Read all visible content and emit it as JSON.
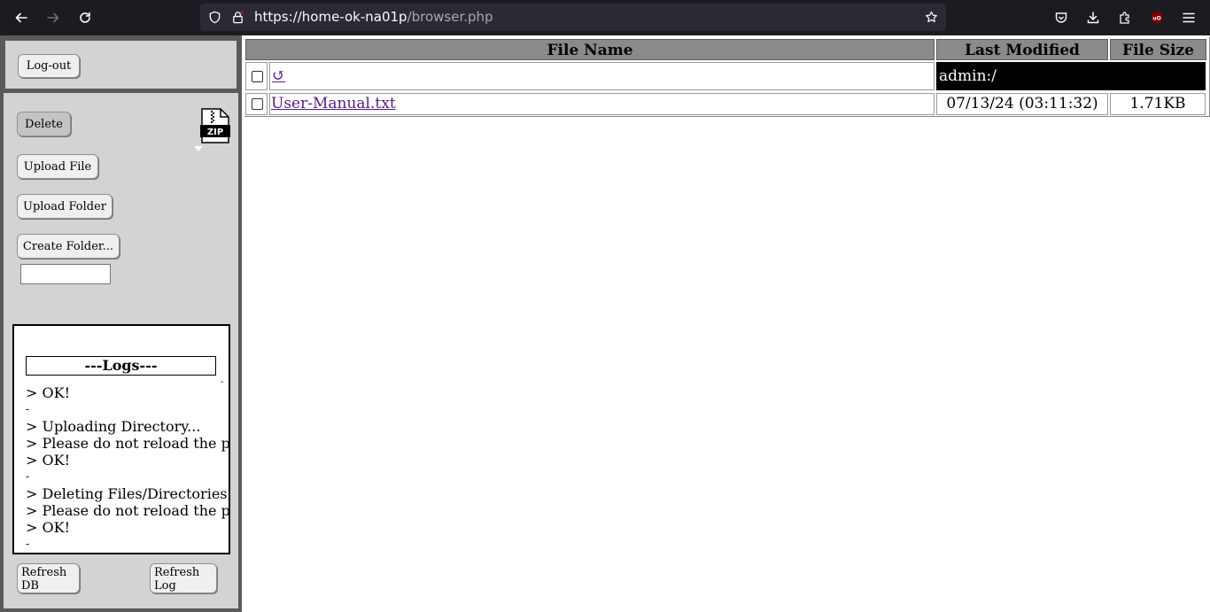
{
  "browser": {
    "url_host": "https://home-ok-na01p",
    "url_path": "/browser.php",
    "icons": [
      "back-icon",
      "forward-icon",
      "reload-icon",
      "shield-icon",
      "lock-icon",
      "bookmark-star-icon",
      "pocket-icon",
      "download-icon",
      "extensions-icon",
      "ublock-icon",
      "menu-icon"
    ]
  },
  "sidebar": {
    "logout_label": "Log-out",
    "delete_label": "Delete",
    "upload_file_label": "Upload File",
    "upload_folder_label": "Upload Folder",
    "create_folder_label": "Create Folder...",
    "folder_name_value": "",
    "zip_label": "ZIP",
    "logs": {
      "title": "---Logs---",
      "side_dash": "-",
      "lines": [
        "> OK!",
        "-",
        "> Uploading Directory...",
        "> Please do not reload the p",
        "> OK!",
        "-",
        "> Deleting Files/Directories",
        "> Please do not reload the p",
        "> OK!",
        "-"
      ]
    },
    "refresh_db_line1": "Refresh",
    "refresh_db_line2": "DB",
    "refresh_log_line1": "Refresh",
    "refresh_log_line2": "Log"
  },
  "table": {
    "headers": {
      "file_name": "File Name",
      "last_modified": "Last Modified",
      "file_size": "File Size"
    },
    "parent_row": {
      "icon": "↺",
      "path": "admin:/"
    },
    "rows": [
      {
        "name": "User-Manual.txt",
        "modified": "07/13/24 (03:11:32)",
        "size": "1.71KB"
      }
    ]
  },
  "colors": {
    "chrome_bg": "#1c1b22",
    "sidebar_frame": "#5a5a5a",
    "panel_bg": "#d3d3d3",
    "header_bg": "#8a8a8a",
    "link": "#551a8b"
  }
}
